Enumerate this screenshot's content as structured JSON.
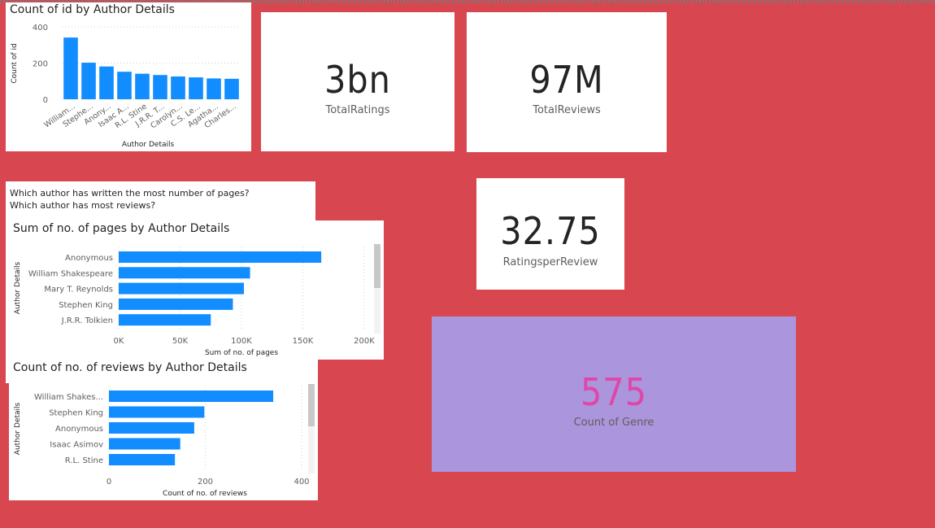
{
  "kpis": {
    "total_ratings": {
      "value": "3bn",
      "label": "TotalRatings"
    },
    "total_reviews": {
      "value": "97M",
      "label": "TotalReviews"
    },
    "ratings_per_review": {
      "value": "32.75",
      "label": "RatingsperReview"
    },
    "count_of_genre": {
      "value": "575",
      "label": "Count of Genre",
      "value_color": "#E046A8",
      "card_color": "#AB95DC"
    }
  },
  "questions": {
    "line1": "Which author has written the most number of pages?",
    "line2": "Which author has most reviews?"
  },
  "colors": {
    "background": "#D84650",
    "bar": "#118DFF"
  },
  "chart_data": [
    {
      "id": "count_by_author",
      "type": "bar",
      "title": "Count of id by Author Details",
      "xlabel": "Author Details",
      "ylabel": "Count of id",
      "ylim": [
        0,
        400
      ],
      "yticks": [
        "0",
        "200",
        "400"
      ],
      "categories": [
        "William...",
        "Stephe...",
        "Anony...",
        "Isaac A...",
        "R.L. Stine",
        "J.R.R. T...",
        "Carolyn...",
        "C.S. Le...",
        "Agatha...",
        "Charles..."
      ],
      "values": [
        341,
        202,
        181,
        152,
        141,
        134,
        126,
        121,
        115,
        113
      ]
    },
    {
      "id": "pages_by_author",
      "type": "bar",
      "orientation": "horizontal",
      "title": "Sum of no. of pages by Author Details",
      "xlabel": "Sum of no. of pages",
      "ylabel": "Author Details",
      "xlim": [
        0,
        200000
      ],
      "xticks": [
        "0K",
        "50K",
        "100K",
        "150K",
        "200K"
      ],
      "categories": [
        "Anonymous",
        "William Shakespeare",
        "Mary T. Reynolds",
        "Stephen King",
        "J.R.R. Tolkien"
      ],
      "values": [
        165000,
        107000,
        102000,
        93000,
        75000
      ]
    },
    {
      "id": "reviews_by_author",
      "type": "bar",
      "orientation": "horizontal",
      "title": "Count of no. of reviews by Author Details",
      "xlabel": "Count of no. of reviews",
      "ylabel": "Author Details",
      "xlim": [
        0,
        400
      ],
      "xticks": [
        "0",
        "200",
        "400"
      ],
      "categories": [
        "William Shakes...",
        "Stephen King",
        "Anonymous",
        "Isaac Asimov",
        "R.L. Stine"
      ],
      "values": [
        341,
        198,
        177,
        148,
        137
      ]
    }
  ]
}
